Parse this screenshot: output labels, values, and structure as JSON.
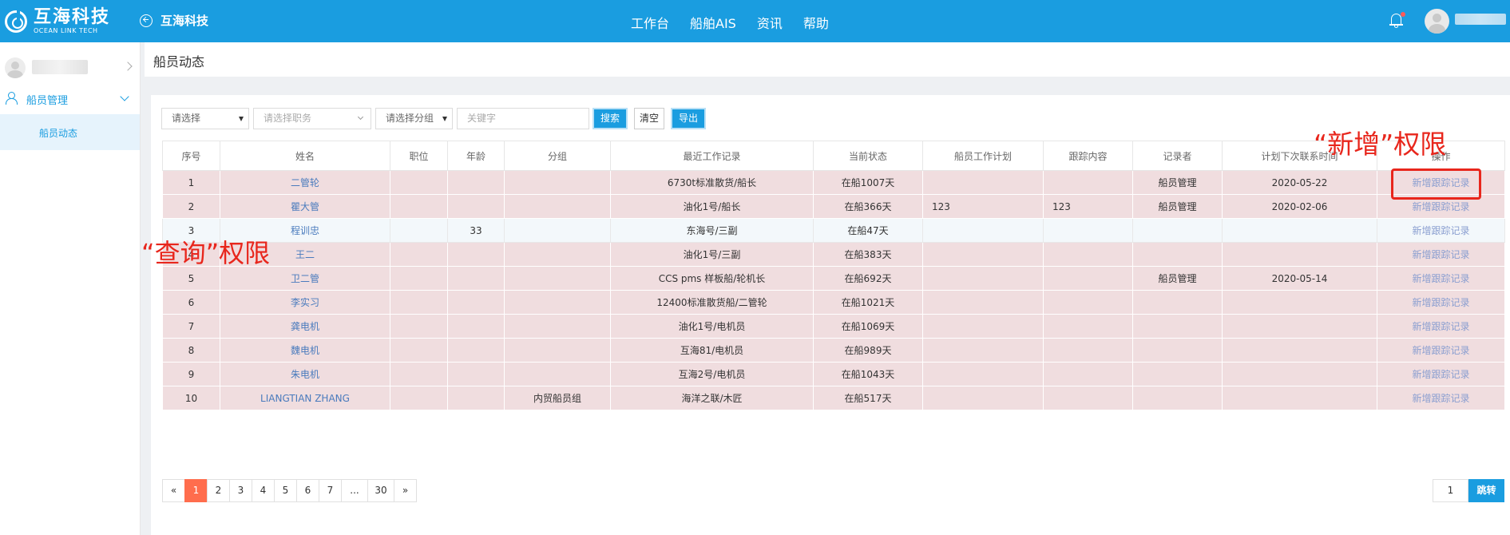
{
  "header": {
    "logo_cn": "互海科技",
    "logo_en": "OCEAN LINK TECH",
    "app_title": "互海科技",
    "nav": [
      "工作台",
      "船舶AIS",
      "资讯",
      "帮助"
    ]
  },
  "sidebar": {
    "group_label": "船员管理",
    "item_label": "船员动态"
  },
  "breadcrumb": {
    "title": "船员动态"
  },
  "filters": {
    "select1": "请选择",
    "select2_placeholder": "请选择职务",
    "select3": "请选择分组",
    "keyword_placeholder": "关键字",
    "search_label": "搜索",
    "clear_label": "清空",
    "export_label": "导出"
  },
  "table": {
    "headers": [
      "序号",
      "姓名",
      "职位",
      "年龄",
      "分组",
      "最近工作记录",
      "当前状态",
      "船员工作计划",
      "跟踪内容",
      "记录者",
      "计划下次联系时间",
      "操作"
    ],
    "rows": [
      {
        "no": "1",
        "name": "二管轮",
        "position": "",
        "age": "",
        "group": "",
        "record": "6730t标准散货/船长",
        "status": "在船1007天",
        "plan": "",
        "track": "",
        "recorder": "船员管理",
        "next": "2020-05-22",
        "op": "新增跟踪记录",
        "style": "pink"
      },
      {
        "no": "2",
        "name": "瞿大管",
        "position": "",
        "age": "",
        "group": "",
        "record": "油化1号/船长",
        "status": "在船366天",
        "plan": "123",
        "track": "123",
        "recorder": "船员管理",
        "next": "2020-02-06",
        "op": "新增跟踪记录",
        "style": "pink"
      },
      {
        "no": "3",
        "name": "程训忠",
        "position": "",
        "age": "33",
        "group": "",
        "record": "东海号/三副",
        "status": "在船47天",
        "plan": "",
        "track": "",
        "recorder": "",
        "next": "",
        "op": "新增跟踪记录",
        "style": "plain"
      },
      {
        "no": "4",
        "name": "王二",
        "position": "",
        "age": "",
        "group": "",
        "record": "油化1号/三副",
        "status": "在船383天",
        "plan": "",
        "track": "",
        "recorder": "",
        "next": "",
        "op": "新增跟踪记录",
        "style": "pink"
      },
      {
        "no": "5",
        "name": "卫二管",
        "position": "",
        "age": "",
        "group": "",
        "record": "CCS pms 样板船/轮机长",
        "status": "在船692天",
        "plan": "",
        "track": "",
        "recorder": "船员管理",
        "next": "2020-05-14",
        "op": "新增跟踪记录",
        "style": "pink"
      },
      {
        "no": "6",
        "name": "李实习",
        "position": "",
        "age": "",
        "group": "",
        "record": "12400标准散货船/二管轮",
        "status": "在船1021天",
        "plan": "",
        "track": "",
        "recorder": "",
        "next": "",
        "op": "新增跟踪记录",
        "style": "pink"
      },
      {
        "no": "7",
        "name": "龚电机",
        "position": "",
        "age": "",
        "group": "",
        "record": "油化1号/电机员",
        "status": "在船1069天",
        "plan": "",
        "track": "",
        "recorder": "",
        "next": "",
        "op": "新增跟踪记录",
        "style": "pink"
      },
      {
        "no": "8",
        "name": "魏电机",
        "position": "",
        "age": "",
        "group": "",
        "record": "互海81/电机员",
        "status": "在船989天",
        "plan": "",
        "track": "",
        "recorder": "",
        "next": "",
        "op": "新增跟踪记录",
        "style": "pink"
      },
      {
        "no": "9",
        "name": "朱电机",
        "position": "",
        "age": "",
        "group": "",
        "record": "互海2号/电机员",
        "status": "在船1043天",
        "plan": "",
        "track": "",
        "recorder": "",
        "next": "",
        "op": "新增跟踪记录",
        "style": "pink"
      },
      {
        "no": "10",
        "name": "LIANGTIAN ZHANG",
        "position": "",
        "age": "",
        "group": "内贸船员组",
        "record": "海洋之联/木匠",
        "status": "在船517天",
        "plan": "",
        "track": "",
        "recorder": "",
        "next": "",
        "op": "新增跟踪记录",
        "style": "pink"
      }
    ]
  },
  "pagination": {
    "prev": "«",
    "pages": [
      "1",
      "2",
      "3",
      "4",
      "5",
      "6",
      "7",
      "...",
      "30"
    ],
    "next": "»",
    "current": "1",
    "jump_value": "1",
    "jump_label": "跳转"
  },
  "annotations": {
    "add_permission": "“新增”权限",
    "query_permission": "“查询”权限"
  },
  "colors": {
    "primary": "#1a9de0",
    "row_highlight": "#f0dddf",
    "pager_active": "#ff6d4d",
    "annotation": "#e8261c"
  }
}
